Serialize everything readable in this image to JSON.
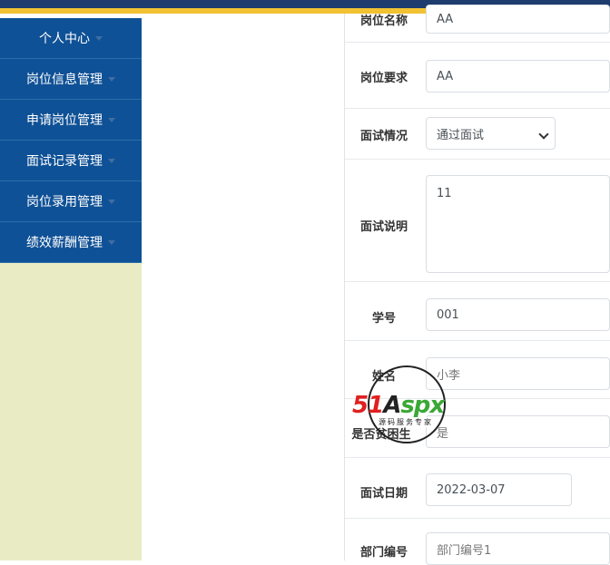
{
  "sidebar": {
    "items": [
      {
        "label": "个人中心"
      },
      {
        "label": "岗位信息管理"
      },
      {
        "label": "申请岗位管理"
      },
      {
        "label": "面试记录管理"
      },
      {
        "label": "岗位录用管理"
      },
      {
        "label": "绩效薪酬管理"
      }
    ]
  },
  "form": {
    "position_name": {
      "label": "岗位名称",
      "value": "AA"
    },
    "position_req": {
      "label": "岗位要求",
      "value": "AA"
    },
    "interview_status": {
      "label": "面试情况",
      "value": "通过面试"
    },
    "interview_desc": {
      "label": "面试说明",
      "value": "11"
    },
    "student_no": {
      "label": "学号",
      "value": "001"
    },
    "name": {
      "label": "姓名",
      "value": "小李"
    },
    "poor_student": {
      "label": "是否贫困生",
      "value": "是"
    },
    "interview_date": {
      "label": "面试日期",
      "value": "2022-03-07"
    },
    "dept_no": {
      "label": "部门编号",
      "value": "部门编号1"
    }
  },
  "watermark": {
    "logo": "51Aspx",
    "tagline": "源码服务专家"
  },
  "colors": {
    "topbar": "#1e3c6e",
    "gold": "#f1c232",
    "nav": "#0f5196",
    "sidebar_bg": "#e9ebc4"
  }
}
